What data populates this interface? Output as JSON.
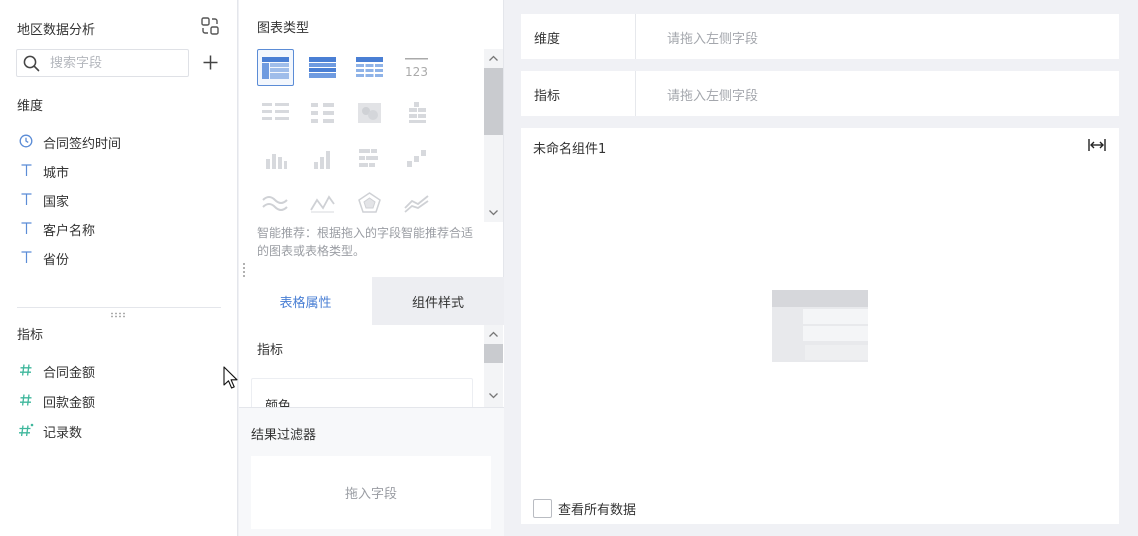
{
  "left": {
    "title": "地区数据分析",
    "search_placeholder": "搜索字段",
    "dimension_label": "维度",
    "dimensions": [
      {
        "icon": "clock-icon",
        "label": "合同签约时间"
      },
      {
        "icon": "text-type-icon",
        "label": "城市"
      },
      {
        "icon": "text-type-icon",
        "label": "国家"
      },
      {
        "icon": "text-type-icon",
        "label": "客户名称"
      },
      {
        "icon": "text-type-icon",
        "label": "省份"
      }
    ],
    "metric_label": "指标",
    "metrics": [
      {
        "icon": "number-type-icon",
        "label": "合同金额"
      },
      {
        "icon": "number-type-icon",
        "label": "回款金额"
      },
      {
        "icon": "record-count-icon",
        "label": "记录数"
      }
    ]
  },
  "middle": {
    "chart_type_title": "图表类型",
    "selected_chart_index": 0,
    "chart_types": [
      "grouped-table-icon",
      "detail-table-icon",
      "cross-table-icon",
      "kpi-number-icon",
      "table-variant-a-icon",
      "table-variant-b-icon",
      "heatmap-icon",
      "table-variant-c-icon",
      "column-chart-icon",
      "bar-ascending-icon",
      "stacked-bar-icon",
      "scatter-step-icon",
      "area-wave-icon",
      "line-chart-icon",
      "radar-chart-icon",
      "multi-line-icon"
    ],
    "hint": "智能推荐：根据拖入的字段智能推荐合适的图表或表格类型。",
    "tabs": {
      "active": "表格属性",
      "inactive": "组件样式"
    },
    "prop_section": "指标",
    "prop_card": "颜色",
    "filter_title": "结果过滤器",
    "filter_drop": "拖入字段"
  },
  "right": {
    "dimension_shelf": {
      "label": "维度",
      "placeholder": "请拖入左侧字段"
    },
    "metric_shelf": {
      "label": "指标",
      "placeholder": "请拖入左侧字段"
    },
    "widget_title": "未命名组件1",
    "view_all_label": "查看所有数据"
  },
  "colors": {
    "accent": "#4a7fd4",
    "text_icon": "#5b8cd6",
    "number_icon": "#3fb79c"
  }
}
